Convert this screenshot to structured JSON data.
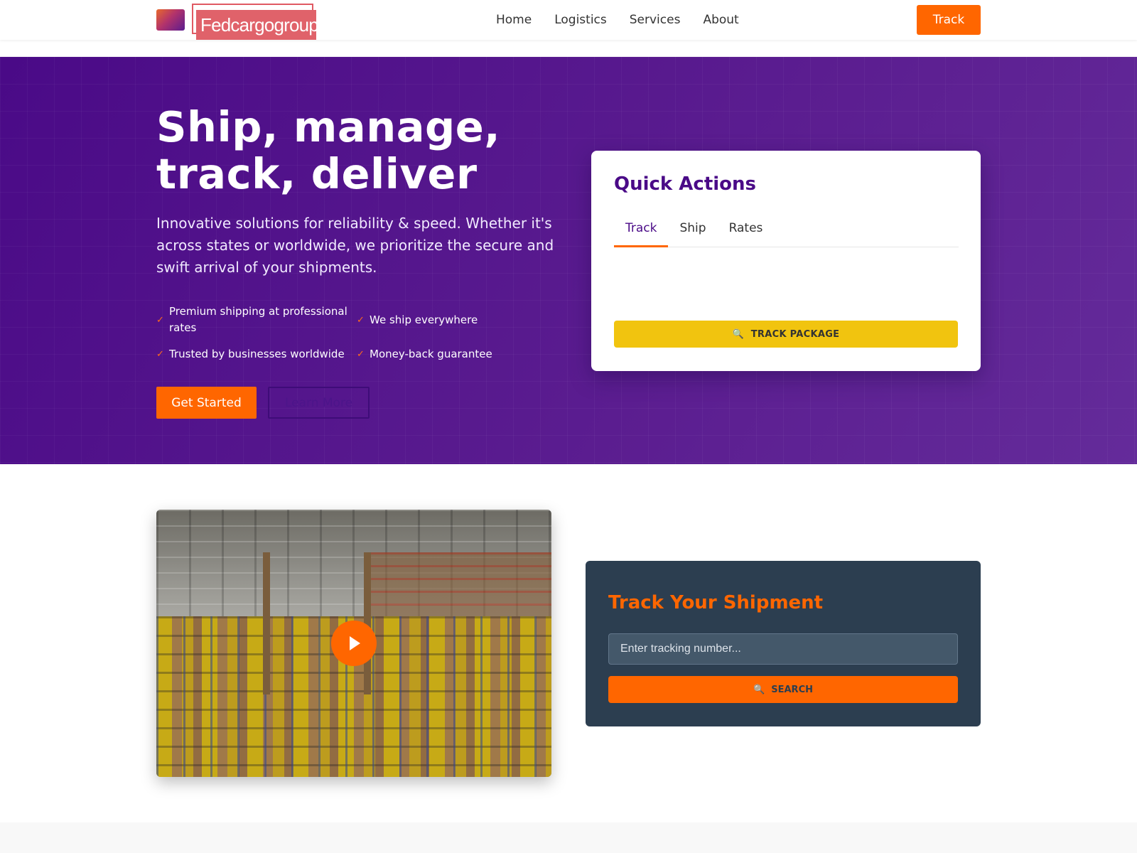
{
  "brand": {
    "name": "Fedcargogroup"
  },
  "nav": {
    "links": [
      {
        "label": "Home"
      },
      {
        "label": "Logistics"
      },
      {
        "label": "Services"
      },
      {
        "label": "About"
      }
    ],
    "track_label": "Track"
  },
  "hero": {
    "title": "Ship, manage, track, deliver",
    "description": "Innovative solutions for reliability & speed. Whether it's across states or worldwide, we prioritize the secure and swift arrival of your shipments.",
    "features": [
      {
        "icon": "check-icon",
        "text": "Premium shipping at professional rates"
      },
      {
        "icon": "check-icon",
        "text": "We ship everywhere"
      },
      {
        "icon": "check-icon",
        "text": "Trusted by businesses worldwide"
      },
      {
        "icon": "check-icon",
        "text": "Money-back guarantee"
      }
    ],
    "get_started_label": "Get Started",
    "learn_more_label": "Learn More"
  },
  "quick_actions": {
    "title": "Quick Actions",
    "tabs": [
      {
        "label": "Track",
        "active": true
      },
      {
        "label": "Ship",
        "active": false
      },
      {
        "label": "Rates",
        "active": false
      }
    ],
    "button_icon": "🔍",
    "button_label": "TRACK PACKAGE"
  },
  "video": {
    "icon": "play-icon"
  },
  "track_shipment": {
    "title": "Track Your Shipment",
    "input_placeholder": "Enter tracking number...",
    "input_value": "",
    "button_icon": "🔍",
    "button_label": "SEARCH"
  },
  "colors": {
    "primary_purple": "#4a0a87",
    "accent_orange": "#ff6600",
    "yellow": "#f1c40f",
    "dark_card": "#2c3e50"
  }
}
